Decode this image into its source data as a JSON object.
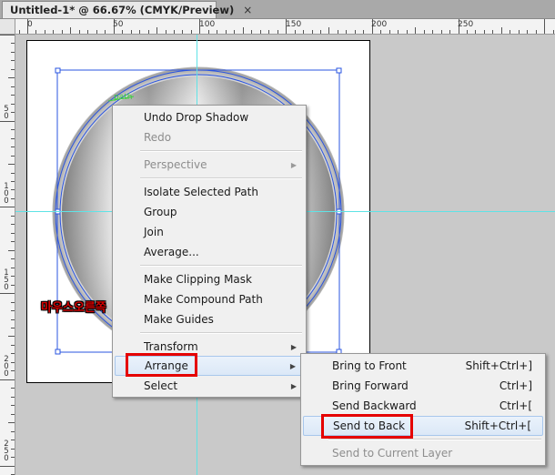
{
  "tab": {
    "title": "Untitled-1* @ 66.67% (CMYK/Preview)",
    "close": "×"
  },
  "ruler_top_labels": [
    "0",
    "50",
    "100",
    "150",
    "200",
    "250"
  ],
  "ruler_left_labels": [
    "5\n0",
    "1\n0\n0",
    "1\n5\n0",
    "2\n0\n0",
    "2\n5\n0"
  ],
  "canvas": {
    "path_hint": "path",
    "hangul_label": "마우스오른쪽",
    "colors": {
      "guide": "#5fe3e6",
      "selection": "#2a54e0",
      "highlight_box": "#e50000"
    }
  },
  "context_menu": {
    "items": [
      {
        "label": "Undo Drop Shadow",
        "enabled": true
      },
      {
        "label": "Redo",
        "enabled": false
      },
      {
        "label": "Perspective",
        "enabled": false,
        "submenu": true
      },
      {
        "label": "Isolate Selected Path",
        "enabled": true
      },
      {
        "label": "Group",
        "enabled": true
      },
      {
        "label": "Join",
        "enabled": true
      },
      {
        "label": "Average...",
        "enabled": true
      },
      {
        "label": "Make Clipping Mask",
        "enabled": true
      },
      {
        "label": "Make Compound Path",
        "enabled": true
      },
      {
        "label": "Make Guides",
        "enabled": true
      },
      {
        "label": "Transform",
        "enabled": true,
        "submenu": true
      },
      {
        "label": "Arrange",
        "enabled": true,
        "submenu": true,
        "highlighted": true
      },
      {
        "label": "Select",
        "enabled": true,
        "submenu": true
      }
    ]
  },
  "arrange_submenu": {
    "items": [
      {
        "label": "Bring to Front",
        "shortcut": "Shift+Ctrl+]",
        "enabled": true
      },
      {
        "label": "Bring Forward",
        "shortcut": "Ctrl+]",
        "enabled": true
      },
      {
        "label": "Send Backward",
        "shortcut": "Ctrl+[",
        "enabled": true
      },
      {
        "label": "Send to Back",
        "shortcut": "Shift+Ctrl+[",
        "enabled": true,
        "highlighted": true
      },
      {
        "label": "Send to Current Layer",
        "shortcut": "",
        "enabled": false
      }
    ]
  }
}
